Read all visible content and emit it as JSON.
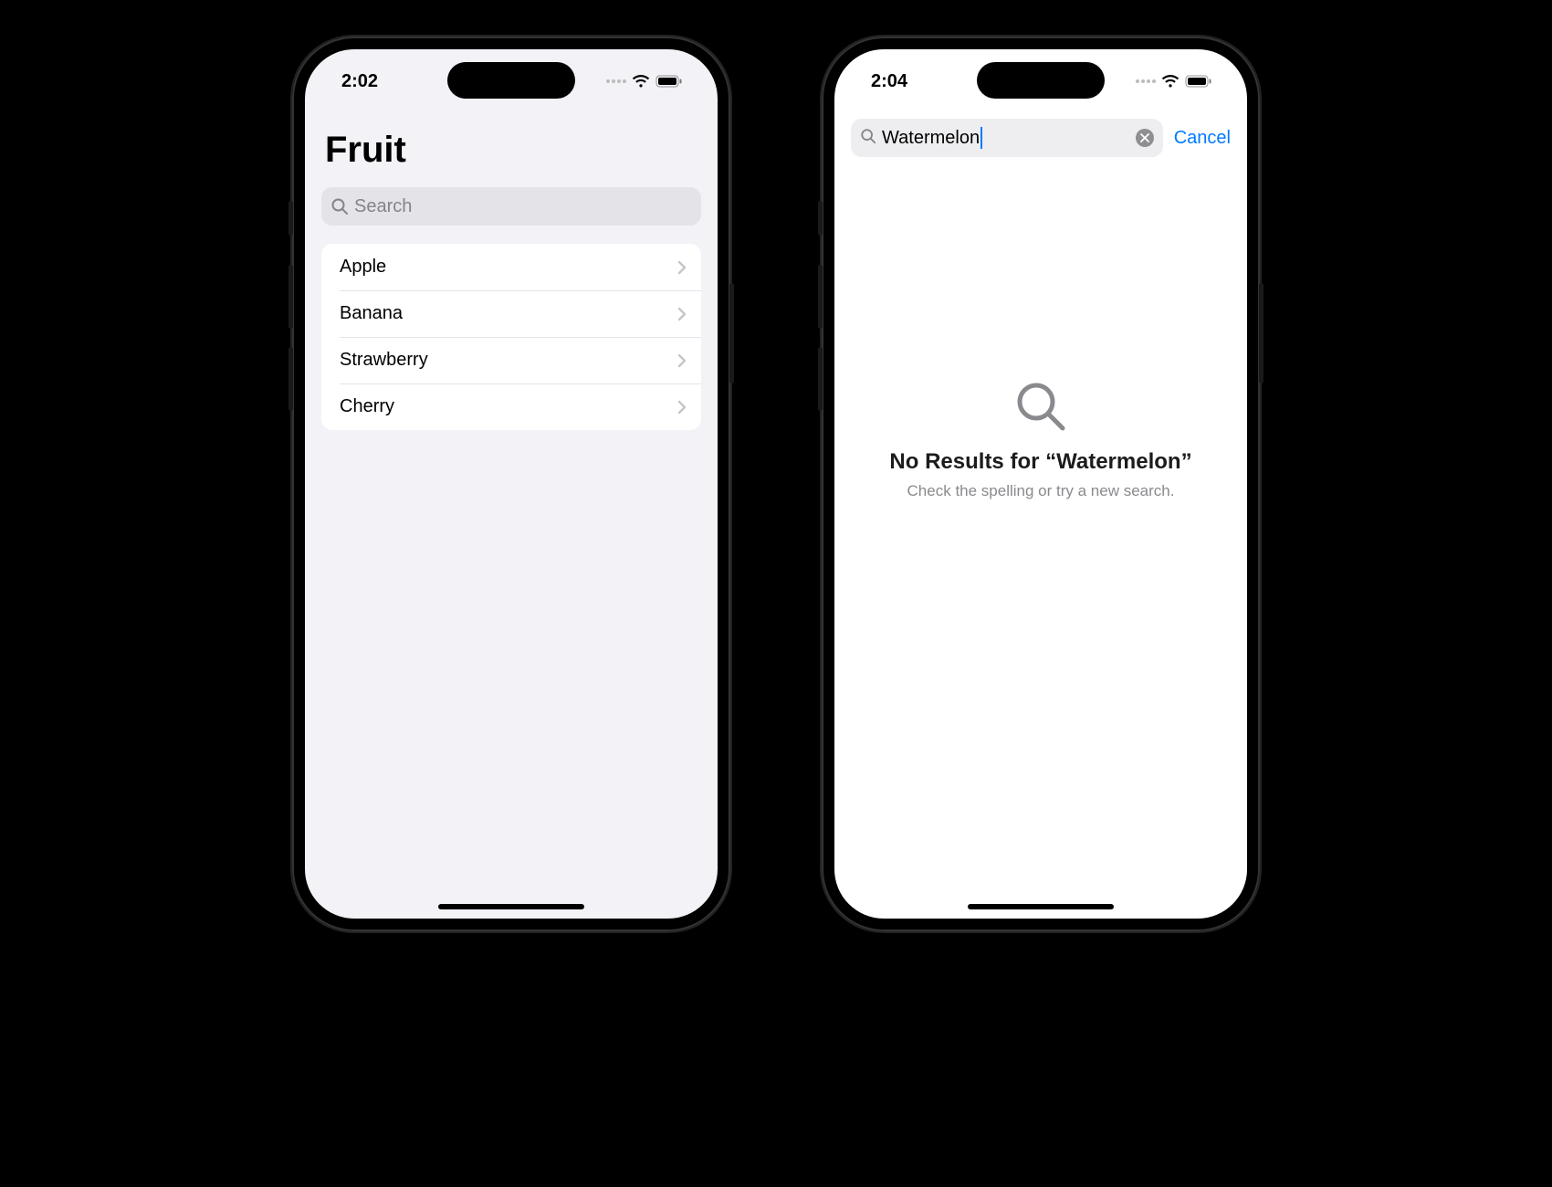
{
  "left": {
    "status": {
      "time": "2:02"
    },
    "title": "Fruit",
    "search": {
      "placeholder": "Search"
    },
    "items": [
      {
        "label": "Apple"
      },
      {
        "label": "Banana"
      },
      {
        "label": "Strawberry"
      },
      {
        "label": "Cherry"
      }
    ]
  },
  "right": {
    "status": {
      "time": "2:04"
    },
    "search": {
      "query": "Watermelon",
      "cancel_label": "Cancel"
    },
    "empty_state": {
      "title": "No Results for “Watermelon”",
      "subtitle": "Check the spelling or try a new search."
    }
  },
  "colors": {
    "accent": "#007aff",
    "grouped_bg": "#f2f2f7",
    "secondary_text": "#8a8a8e"
  }
}
